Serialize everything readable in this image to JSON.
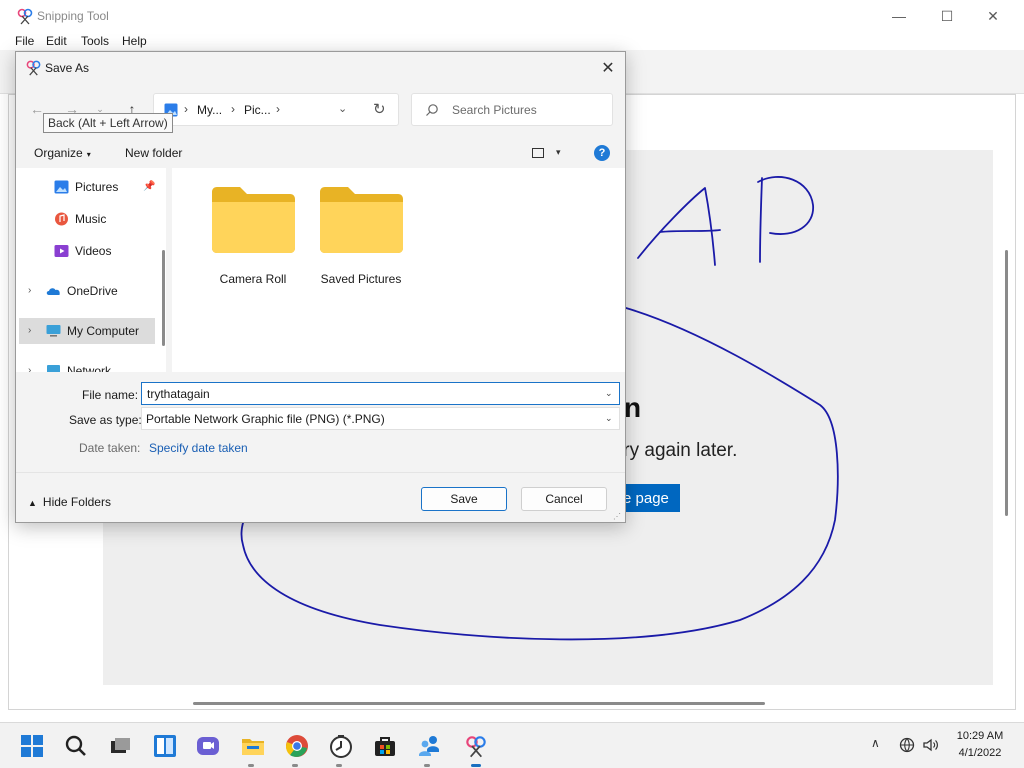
{
  "app": {
    "title": "Snipping Tool",
    "menu": [
      "File",
      "Edit",
      "Tools",
      "Help"
    ],
    "window_controls": {
      "minimize": "—",
      "maximize": "☐",
      "close": "✕"
    }
  },
  "background_page": {
    "heading_fragment": "n",
    "text_fragment": "try again later.",
    "button_fragment": "e page",
    "ink_text": "AP",
    "ink_color": "#1a1aa8"
  },
  "dialog": {
    "title": "Save As",
    "close": "✕",
    "nav": {
      "back": "←",
      "forward": "→",
      "recent": "⌄",
      "up": "↑"
    },
    "tooltip": "Back (Alt + Left Arrow)",
    "address": {
      "crumbs": [
        "My...",
        "Pic..."
      ],
      "separator": "›",
      "dropdown": "⌄",
      "refresh": "↻"
    },
    "search": {
      "placeholder": "Search Pictures"
    },
    "commands": {
      "organize": "Organize",
      "organize_caret": "▾",
      "new_folder": "New folder",
      "view_caret": "▾",
      "help": "?"
    },
    "nav_pane": {
      "items": [
        {
          "label": "Pictures",
          "icon": "pictures-icon",
          "pinned": true
        },
        {
          "label": "Music",
          "icon": "music-icon"
        },
        {
          "label": "Videos",
          "icon": "videos-icon"
        },
        {
          "label": "OneDrive",
          "icon": "onedrive-icon",
          "chevron": "›"
        },
        {
          "label": "My Computer",
          "icon": "computer-icon",
          "chevron": "›",
          "selected": true
        },
        {
          "label": "Network",
          "icon": "network-icon",
          "chevron": "›"
        }
      ],
      "pin_glyph": "📌"
    },
    "folders": [
      {
        "label": "Camera Roll",
        "icon": "folder-icon"
      },
      {
        "label": "Saved Pictures",
        "icon": "folder-icon"
      }
    ],
    "form": {
      "file_name_label": "File name:",
      "file_name_value": "trythatagain",
      "save_type_label": "Save as type:",
      "save_type_value": "Portable Network Graphic file (PNG) (*.PNG)",
      "date_taken_label": "Date taken:",
      "date_taken_link": "Specify date taken",
      "caret": "⌄"
    },
    "footer": {
      "hide_folders": "Hide Folders",
      "hide_caret": "▲",
      "save": "Save",
      "cancel": "Cancel"
    },
    "accent_color": "#1a73c8"
  },
  "taskbar": {
    "icons": [
      "start-icon",
      "search-icon",
      "task-view-icon",
      "widgets-icon",
      "teams-chat-icon",
      "file-explorer-icon",
      "chrome-icon",
      "clock-app-icon",
      "store-icon",
      "people-icon",
      "snipping-tool-icon"
    ],
    "tray_caret": "∧",
    "time": "10:29 AM",
    "date": "4/1/2022"
  }
}
